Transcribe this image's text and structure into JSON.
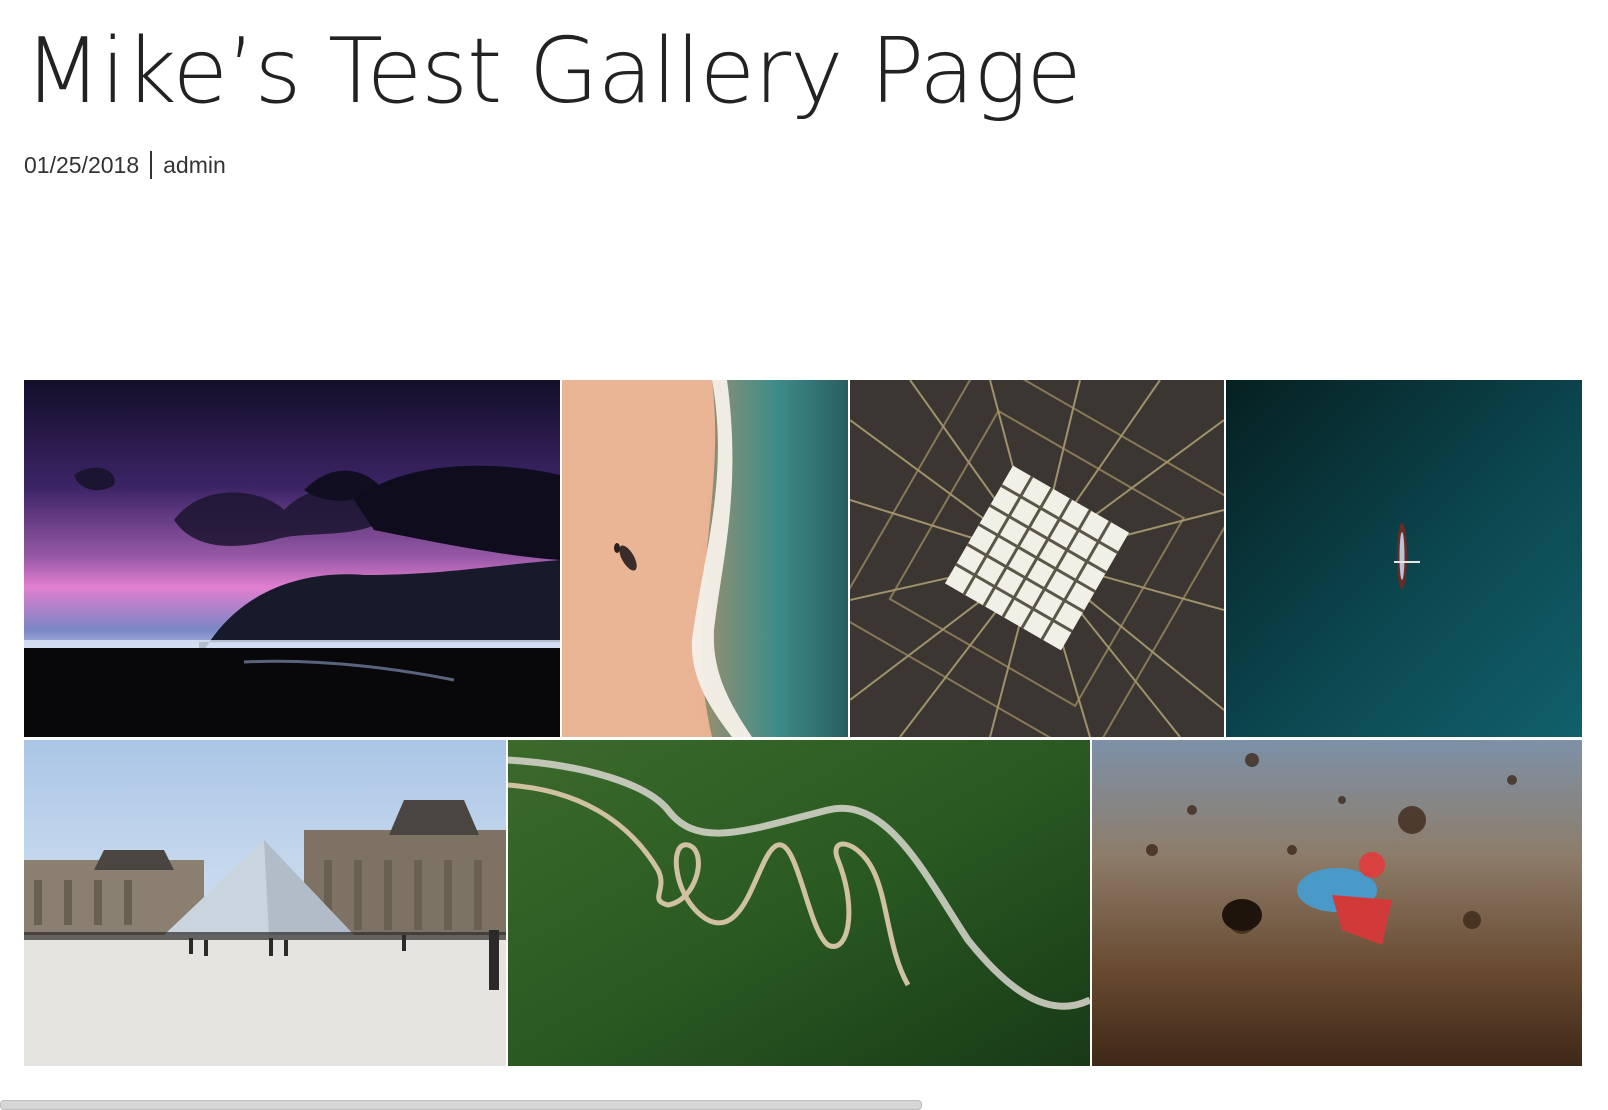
{
  "post": {
    "title": "Mike’s Test Gallery Page",
    "date": "01/25/2018",
    "author": "admin"
  },
  "gallery": {
    "images": [
      {
        "id": "purple-sky-coast"
      },
      {
        "id": "aerial-beach-waves"
      },
      {
        "id": "skylight-grid"
      },
      {
        "id": "kayak-ocean"
      },
      {
        "id": "louvre-pyramid"
      },
      {
        "id": "winding-mountain-road"
      },
      {
        "id": "motocross-dirt"
      }
    ]
  },
  "colors": {
    "text": "#222222",
    "background": "#ffffff"
  }
}
